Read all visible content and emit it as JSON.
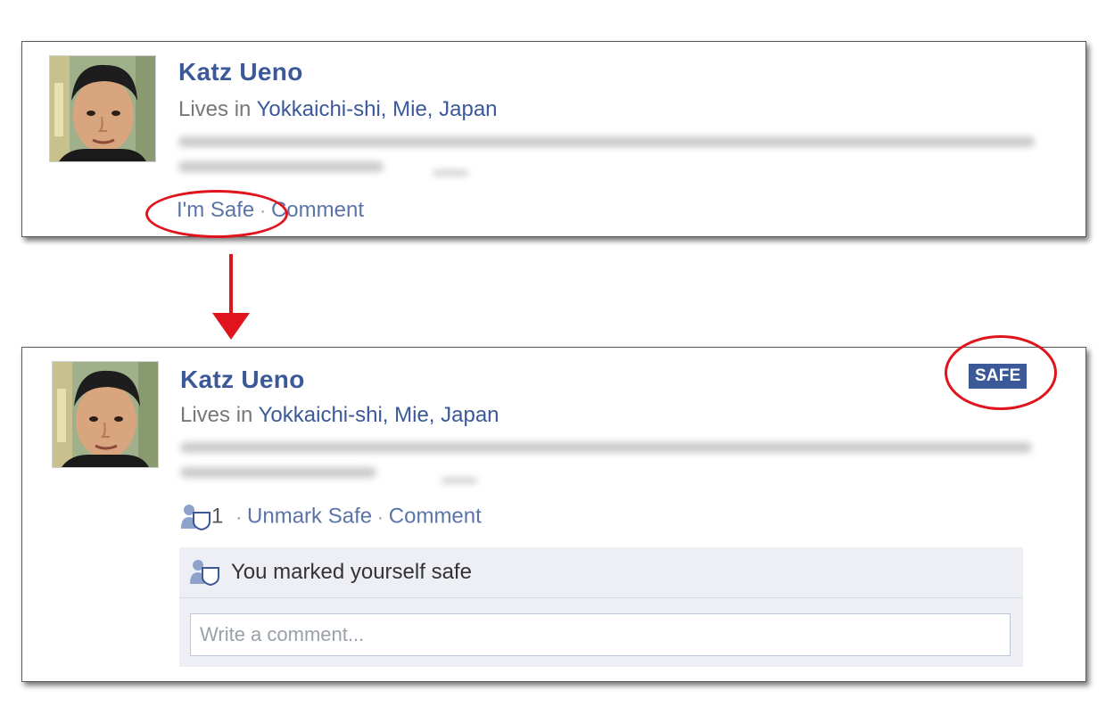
{
  "top_card": {
    "name": "Katz Ueno",
    "lives_prefix": "Lives in ",
    "location": "Yokkaichi-shi, Mie, Japan",
    "im_safe_label": "I'm Safe",
    "separator": "·",
    "comment_label": "Comment"
  },
  "bottom_card": {
    "name": "Katz Ueno",
    "lives_prefix": "Lives in ",
    "location": "Yokkaichi-shi, Mie, Japan",
    "safe_badge": "SAFE",
    "safe_count": "1",
    "separator": "·",
    "unmark_label": "Unmark Safe",
    "comment_label": "Comment",
    "marked_text": "You marked yourself safe",
    "comment_placeholder": "Write a comment..."
  },
  "colors": {
    "link": "#3b5998",
    "annotation": "#e0141c",
    "badge": "#3b5998"
  },
  "icons": {
    "safe_icon": "person-shield-icon",
    "arrow": "down-arrow-icon"
  }
}
